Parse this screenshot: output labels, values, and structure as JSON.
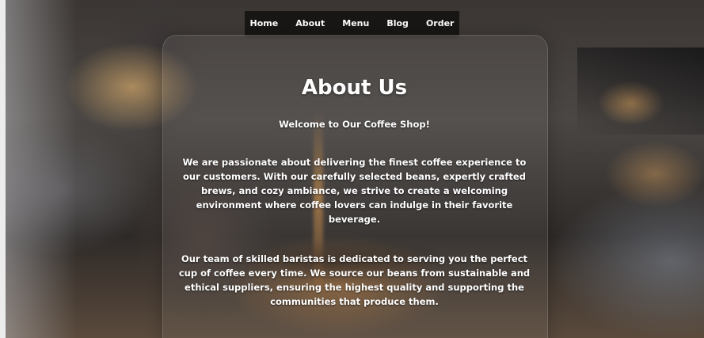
{
  "nav": {
    "items": [
      {
        "label": "Home"
      },
      {
        "label": "About"
      },
      {
        "label": "Menu"
      },
      {
        "label": "Blog"
      },
      {
        "label": "Order"
      }
    ]
  },
  "about": {
    "title": "About Us",
    "subtitle": "Welcome to Our Coffee Shop!",
    "paragraph1": "We are passionate about delivering the finest coffee experience to our customers. With our carefully selected beans, expertly crafted brews, and cozy ambiance, we strive to create a welcoming environment where coffee lovers can indulge in their favorite beverage.",
    "paragraph2": "Our team of skilled baristas is dedicated to serving you the perfect cup of coffee every time. We source our beans from sustainable and ethical suppliers, ensuring the highest quality and supporting the communities that produce them."
  },
  "colors": {
    "text": "#ffffff",
    "navbar_bg": "#0a0a0a"
  }
}
